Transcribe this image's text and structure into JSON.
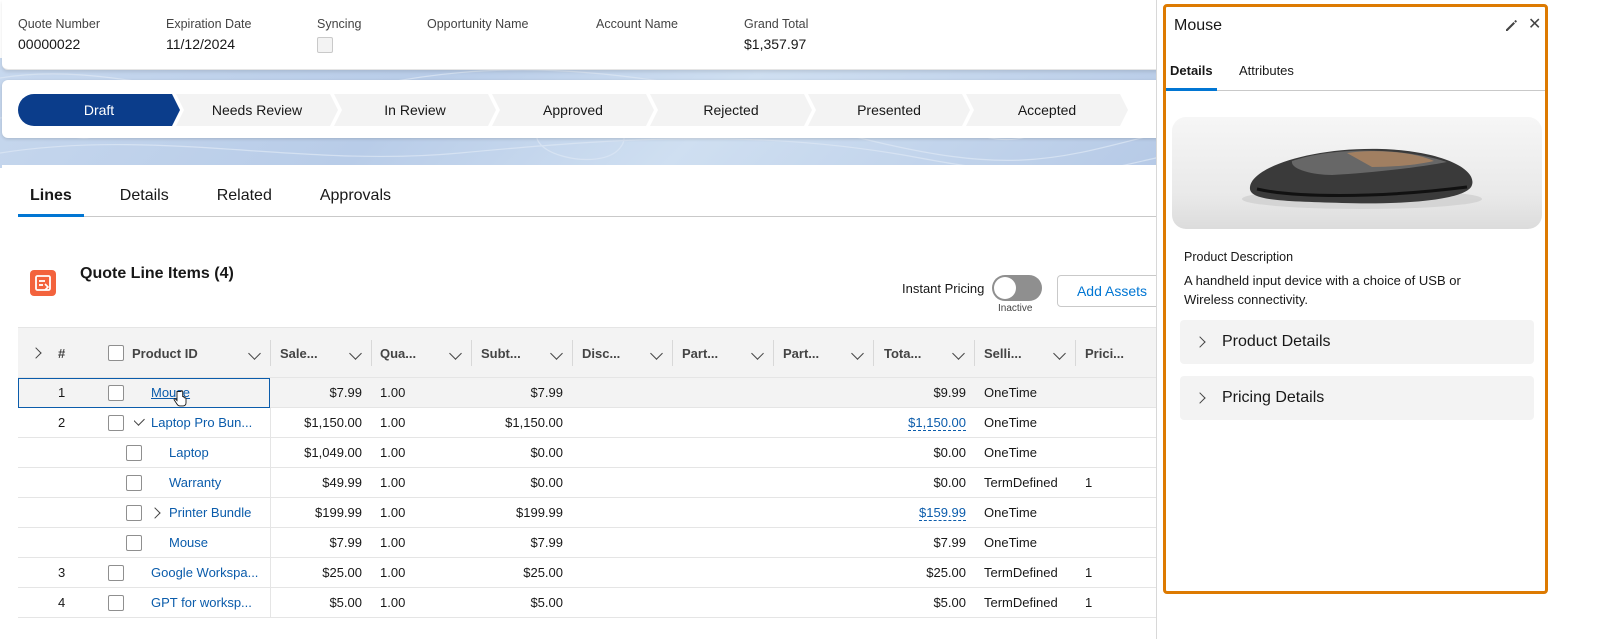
{
  "highlights": {
    "quote_number_label": "Quote Number",
    "quote_number": "00000022",
    "expiration_label": "Expiration Date",
    "expiration": "11/12/2024",
    "syncing_label": "Syncing",
    "opportunity_label": "Opportunity Name",
    "account_label": "Account Name",
    "grand_total_label": "Grand Total",
    "grand_total": "$1,357.97"
  },
  "path": {
    "stages": [
      "Draft",
      "Needs Review",
      "In Review",
      "Approved",
      "Rejected",
      "Presented",
      "Accepted"
    ],
    "active": "Draft"
  },
  "tabs": [
    "Lines",
    "Details",
    "Related",
    "Approvals"
  ],
  "qli": {
    "title": "Quote Line Items (4)",
    "instant_pricing_label": "Instant Pricing",
    "instant_pricing_state": "Inactive",
    "add_assets": "Add Assets"
  },
  "table": {
    "headers": [
      "#",
      "Product ID",
      "Sale...",
      "Qua...",
      "Subt...",
      "Disc...",
      "Part...",
      "Part...",
      "Tota...",
      "Selli...",
      "Prici..."
    ],
    "rows": [
      {
        "num": "1",
        "product": "Mouse",
        "sale": "$7.99",
        "qty": "1.00",
        "subtotal": "$7.99",
        "total": "$9.99",
        "selling": "OneTime",
        "pricing": ""
      },
      {
        "num": "2",
        "product": "Laptop Pro Bun...",
        "sale": "$1,150.00",
        "qty": "1.00",
        "subtotal": "$1,150.00",
        "total": "$1,150.00",
        "selling": "OneTime",
        "pricing": ""
      },
      {
        "num": "",
        "product": "Laptop",
        "sale": "$1,049.00",
        "qty": "1.00",
        "subtotal": "$0.00",
        "total": "$0.00",
        "selling": "OneTime",
        "pricing": ""
      },
      {
        "num": "",
        "product": "Warranty",
        "sale": "$49.99",
        "qty": "1.00",
        "subtotal": "$0.00",
        "total": "$0.00",
        "selling": "TermDefined",
        "pricing": "1"
      },
      {
        "num": "",
        "product": "Printer Bundle",
        "sale": "$199.99",
        "qty": "1.00",
        "subtotal": "$199.99",
        "total": "$159.99",
        "selling": "OneTime",
        "pricing": ""
      },
      {
        "num": "",
        "product": "Mouse",
        "sale": "$7.99",
        "qty": "1.00",
        "subtotal": "$7.99",
        "total": "$7.99",
        "selling": "OneTime",
        "pricing": ""
      },
      {
        "num": "3",
        "product": "Google Workspa...",
        "sale": "$25.00",
        "qty": "1.00",
        "subtotal": "$25.00",
        "total": "$25.00",
        "selling": "TermDefined",
        "pricing": "1"
      },
      {
        "num": "4",
        "product": "GPT for worksp...",
        "sale": "$5.00",
        "qty": "1.00",
        "subtotal": "$5.00",
        "total": "$5.00",
        "selling": "TermDefined",
        "pricing": "1"
      }
    ]
  },
  "panel": {
    "title": "Mouse",
    "tabs": [
      "Details",
      "Attributes"
    ],
    "desc_label": "Product Description",
    "desc": "A handheld input device with a choice of USB or Wireless connectivity.",
    "sections": [
      "Product Details",
      "Pricing Details"
    ]
  },
  "colors": {
    "brand": "#0176d3",
    "path_active": "#0b3d8b",
    "panel_highlight": "#dd7a01",
    "qli_icon": "#f3633d"
  }
}
